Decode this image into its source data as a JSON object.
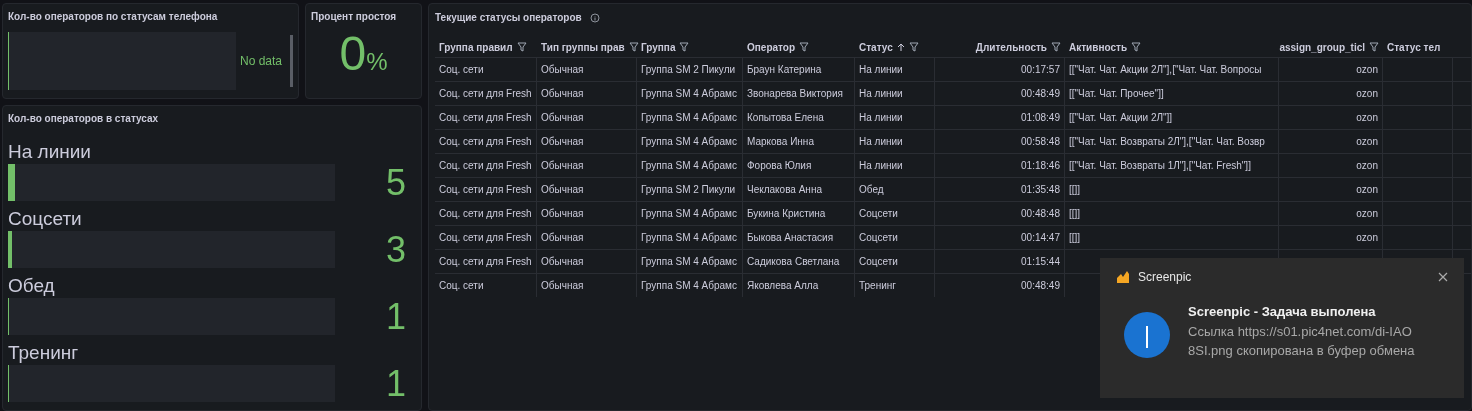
{
  "phone_panel": {
    "title": "Кол-во операторов по статусам телефона",
    "empty_text": "No data"
  },
  "idle_panel": {
    "title": "Процент простоя",
    "value": "0",
    "unit": "%"
  },
  "status_panel": {
    "title": "Кол-во операторов в статусах",
    "bars": [
      {
        "label": "На линии",
        "value": "5",
        "level": 0.02
      },
      {
        "label": "Соцсети",
        "value": "3",
        "level": 0.012
      },
      {
        "label": "Обед",
        "value": "1",
        "level": 0.004
      },
      {
        "label": "Тренинг",
        "value": "1",
        "level": 0.004
      }
    ]
  },
  "table_panel": {
    "title": "Текущие статусы операторов",
    "columns": [
      {
        "label": "Группа правил",
        "filter": true,
        "sorted": false
      },
      {
        "label": "Тип группы прав",
        "filter": true,
        "sorted": false
      },
      {
        "label": "Группа",
        "filter": true,
        "sorted": false
      },
      {
        "label": "Оператор",
        "filter": true,
        "sorted": false
      },
      {
        "label": "Статус",
        "filter": true,
        "sorted": true
      },
      {
        "label": "Длительность",
        "filter": true,
        "sorted": false
      },
      {
        "label": "Активность",
        "filter": true,
        "sorted": false
      },
      {
        "label": "assign_group_ticl",
        "filter": true,
        "sorted": false
      },
      {
        "label": "Статус тел",
        "filter": false,
        "sorted": false
      }
    ],
    "rows": [
      [
        "Соц. сети",
        "Обычная",
        "Группа SM 2 Пикули",
        "Браун Катерина",
        "На линии",
        "00:17:57",
        "[[\"Чат. Чат. Акции 2Л\"],[\"Чат. Чат. Вопросы",
        "ozon"
      ],
      [
        "Соц. сети для Fresh",
        "Обычная",
        "Группа SM 4 Абрамс",
        "Звонарева Виктория",
        "На линии",
        "00:48:49",
        "[[\"Чат. Чат. Прочее\"]]",
        "ozon"
      ],
      [
        "Соц. сети для Fresh",
        "Обычная",
        "Группа SM 4 Абрамс",
        "Копытова Елена",
        "На линии",
        "01:08:49",
        "[[\"Чат. Чат. Акции 2Л\"]]",
        "ozon"
      ],
      [
        "Соц. сети для Fresh",
        "Обычная",
        "Группа SM 4 Абрамс",
        "Маркова Инна",
        "На линии",
        "00:58:48",
        "[[\"Чат. Чат. Возвраты 2Л\"],[\"Чат. Чат. Возвр",
        "ozon"
      ],
      [
        "Соц. сети для Fresh",
        "Обычная",
        "Группа SM 4 Абрамс",
        "Форова Юлия",
        "На линии",
        "01:18:46",
        "[[\"Чат. Чат. Возвраты 1Л\"],[\"Чат. Fresh\"]]",
        "ozon"
      ],
      [
        "Соц. сети для Fresh",
        "Обычная",
        "Группа SM 2 Пикули",
        "Чеклакова Анна",
        "Обед",
        "01:35:48",
        "[[]]",
        "ozon"
      ],
      [
        "Соц. сети для Fresh",
        "Обычная",
        "Группа SM 4 Абрамс",
        "Букина Кристина",
        "Соцсети",
        "00:48:48",
        "[[]]",
        "ozon"
      ],
      [
        "Соц. сети для Fresh",
        "Обычная",
        "Группа SM 4 Абрамс",
        "Быкова Анастасия",
        "Соцсети",
        "00:14:47",
        "[[]]",
        "ozon"
      ],
      [
        "Соц. сети для Fresh",
        "Обычная",
        "Группа SM 4 Абрамс",
        "Садикова Светлана",
        "Соцсети",
        "01:15:44"
      ],
      [
        "Соц. сети",
        "Обычная",
        "Группа SM 4 Абрамс",
        "Яковлева Алла",
        "Тренинг",
        "00:48:49"
      ]
    ]
  },
  "notification": {
    "app": "Screenpic",
    "title": "Screenpic - Задача выполена",
    "message": "Ссылка https://s01.pic4net.com/di-IAO8SI.png скопирована в буфер обмена"
  }
}
